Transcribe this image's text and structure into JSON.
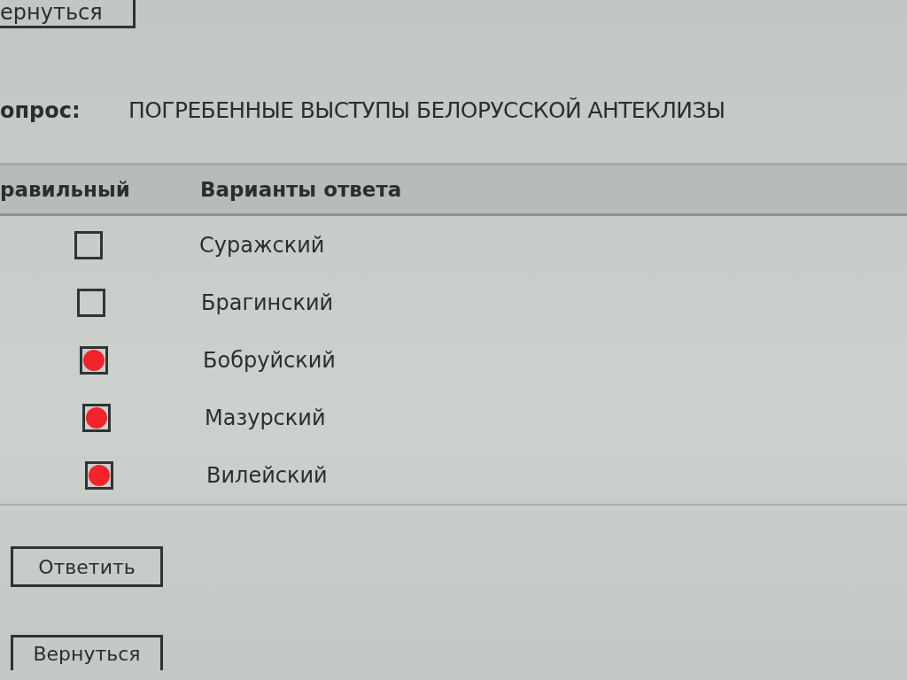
{
  "top_button": {
    "label": "ернуться"
  },
  "question": {
    "label": "опрос:",
    "text": "ПОГРЕБЕННЫЕ ВЫСТУПЫ БЕЛОРУССКОЙ АНТЕКЛИЗЫ"
  },
  "table": {
    "columns": [
      "равильный",
      "Варианты ответа"
    ],
    "rows": [
      {
        "checked": false,
        "answer": "Суражский"
      },
      {
        "checked": false,
        "answer": "Брагинский"
      },
      {
        "checked": true,
        "answer": "Бобруйский"
      },
      {
        "checked": true,
        "answer": "Мазурский"
      },
      {
        "checked": true,
        "answer": "Вилейский"
      }
    ]
  },
  "buttons": [
    "Ответить",
    "Вернуться"
  ]
}
